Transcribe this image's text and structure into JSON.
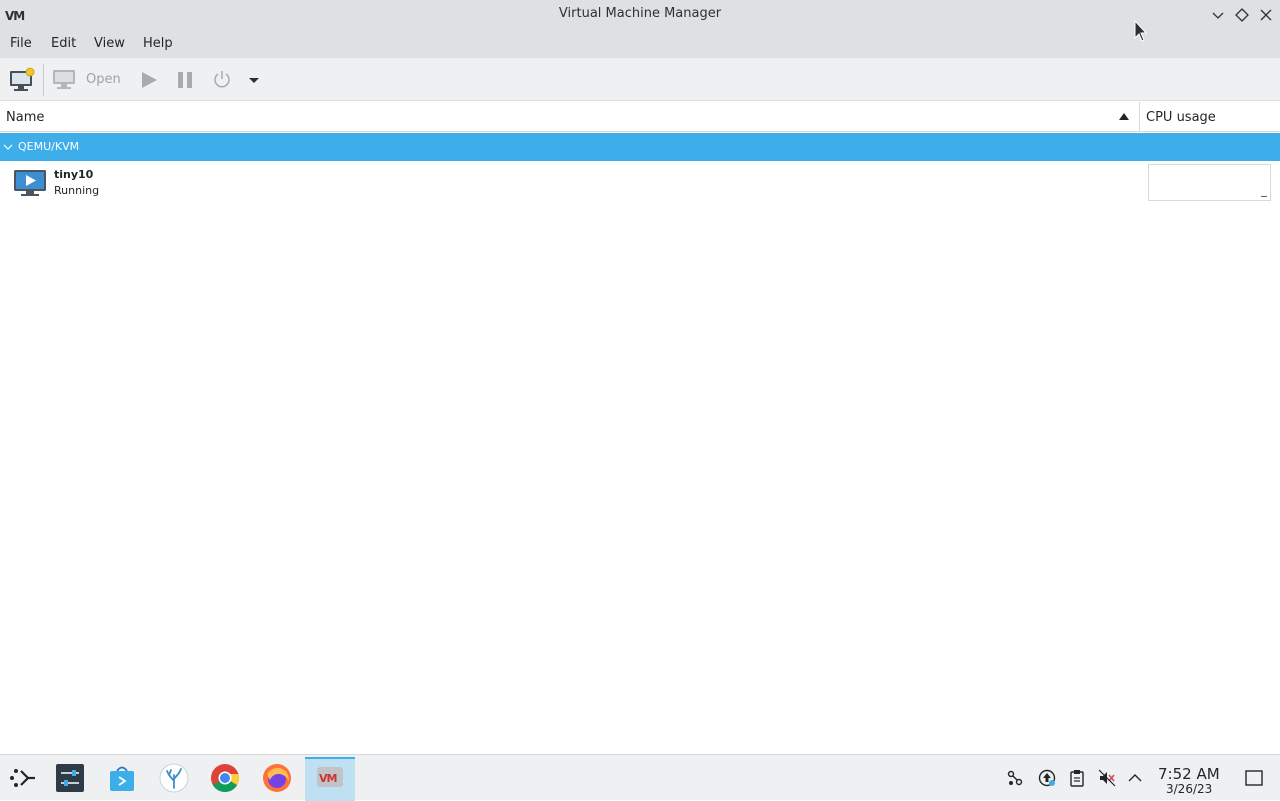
{
  "window": {
    "title": "Virtual Machine Manager",
    "app_logo": "VM"
  },
  "menu": {
    "file": "File",
    "edit": "Edit",
    "view": "View",
    "help": "Help"
  },
  "toolbar": {
    "open_label": "Open"
  },
  "columns": {
    "name": "Name",
    "cpu": "CPU usage"
  },
  "group": {
    "label": "QEMU/KVM"
  },
  "vms": [
    {
      "name": "tiny10",
      "status": "Running"
    }
  ],
  "taskbar": {
    "time": "7:52 AM",
    "date": "3/26/23",
    "active_logo": "VM"
  },
  "colors": {
    "selection": "#3daee9",
    "titlebar": "#dee0e2"
  }
}
